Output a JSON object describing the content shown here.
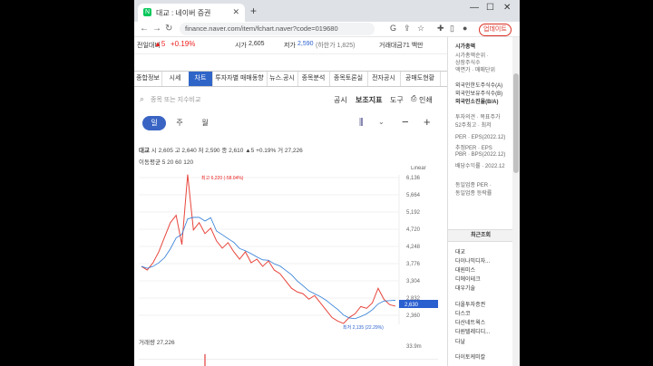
{
  "browser": {
    "tab_title": "대교 : 네이버 증권",
    "url": "finance.naver.com/item/fchart.naver?code=019680",
    "update_label": "업데이트"
  },
  "quote": {
    "prev_label": "전일대비",
    "change": "▲5",
    "change_pct": "+0.19%",
    "high_label": "시가",
    "open": "2,605",
    "low_label": "저가",
    "low": "2,590",
    "low_limit": "(하한가 1,825)",
    "value_label": "거래대금",
    "value": "71 백만"
  },
  "tabs": [
    "종합정보",
    "시세",
    "차트",
    "투자자별 매매동향",
    "뉴스.공시",
    "종목분석",
    "종목토론실",
    "전자공시",
    "공매도현황"
  ],
  "tools": {
    "search_placeholder": "종목 또는 지수비교",
    "disclosure": "공시",
    "indicator": "보조지표",
    "tools": "도구",
    "print": "인쇄"
  },
  "periods": [
    "일",
    "주",
    "월"
  ],
  "info": {
    "name": "대교",
    "line": "시 2,605   고 2,640   저 2,590   종 2,610 ▲5 +0.19%   거 27,226",
    "ma": "이동평균 5 20 60 120"
  },
  "chart_data": {
    "type": "line",
    "y_ticks": [
      "6,136",
      "5,664",
      "5,192",
      "4,720",
      "4,248",
      "3,776",
      "3,304",
      "2,832",
      "2,360"
    ],
    "scale_label": "Linear",
    "current_price": "2,630",
    "max_label": "최고 6,220 (-58.04%)",
    "min_label": "최저 2,135 (22.29%)",
    "series": [
      {
        "values": [
          3700,
          3600,
          3800,
          4100,
          4500,
          4900,
          5100,
          4300,
          6220,
          4700,
          4900,
          4600,
          4750,
          4400,
          4200,
          4350,
          4100,
          3900,
          4100,
          3800,
          3900,
          3700,
          3850,
          3600,
          3500,
          3300,
          3100,
          3000,
          2950,
          2800,
          2900,
          2700,
          2500,
          2300,
          2200,
          2135,
          2300,
          2400,
          2600,
          2550,
          2700,
          3100,
          2800,
          2650,
          2610
        ]
      }
    ]
  },
  "volume": {
    "label": "거래량 27,226",
    "tick": "33.9m"
  },
  "side": {
    "items": [
      "시가총액",
      "시가총액순위 ·",
      "상장주식수",
      "액면가 · 매매단위",
      "외국인한도주식수(A)",
      "외국인보유주식수(B)",
      "외국인소진율(B/A)",
      "투자의견 · 목표주가",
      "52주최고 · 최저",
      "PER · EPS(2022.12)",
      "추정PER · EPS",
      "PBR · BPS(2022.12)",
      "배당수익률 · 2022.12",
      "동일업종 PER ·",
      "동일업종 등락률"
    ],
    "recent_title": "최근조회",
    "recent": [
      "대교",
      "다이나믹디자...",
      "대원미스",
      "디에이테크",
      "대우기술",
      "다올투자증권",
      "다스코",
      "다산네트웍스",
      "다원텔레디디...",
      "다날",
      "다이토케미칼"
    ]
  }
}
